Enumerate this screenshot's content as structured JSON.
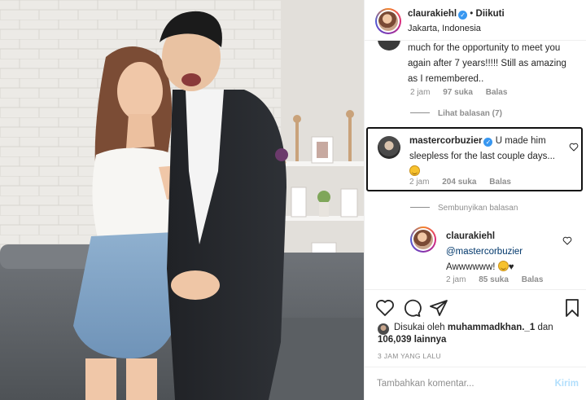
{
  "post": {
    "username": "claurakiehl",
    "follow_status": "Diikuti",
    "separator": "•",
    "location": "Jakarta, Indonesia"
  },
  "comments": [
    {
      "text": "much for the opportunity to meet you again after 7 years!!!!! Still as amazing as I remembered..",
      "time": "2 jam",
      "likes": "97 suka",
      "reply": "Balas",
      "view_replies": "Lihat balasan (7)"
    },
    {
      "username": "mastercorbuzier",
      "text": "U made him sleepless for the last couple days...",
      "time": "2 jam",
      "likes": "204 suka",
      "reply": "Balas",
      "hide_replies": "Sembunyikan balasan"
    },
    {
      "username": "claurakiehl",
      "mention": "@mastercorbuzier",
      "text": "Awwwwww!",
      "time": "2 jam",
      "likes": "85 suka",
      "reply": "Balas"
    }
  ],
  "likes_summary": {
    "prefix": "Disukai oleh",
    "user": "muhammadkhan._1",
    "connector": "dan",
    "count": "106,039",
    "suffix": "lainnya"
  },
  "timestamp": "3 JAM YANG LALU",
  "add_comment": {
    "placeholder": "Tambahkan komentar...",
    "post_label": "Kirim"
  },
  "icons": [
    "heart-icon",
    "comment-icon",
    "share-icon",
    "bookmark-icon",
    "verified-icon"
  ],
  "colors": {
    "verified": "#3897f0",
    "link": "#00376b",
    "muted": "#8e8e8e",
    "post_disabled": "#b2dffc"
  }
}
